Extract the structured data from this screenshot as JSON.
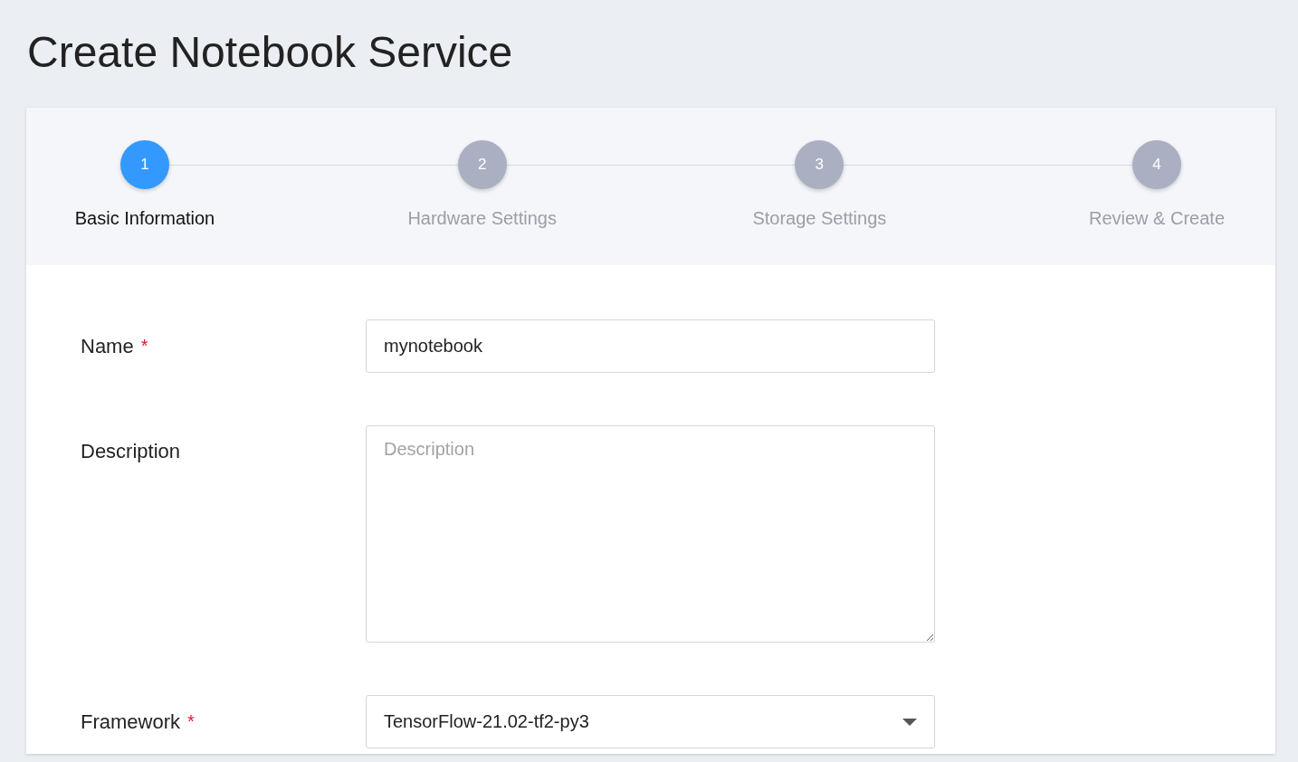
{
  "title": "Create Notebook Service",
  "steps": [
    {
      "number": "1",
      "label": "Basic Information",
      "selected": true
    },
    {
      "number": "2",
      "label": "Hardware Settings",
      "selected": false
    },
    {
      "number": "3",
      "label": "Storage Settings",
      "selected": false
    },
    {
      "number": "4",
      "label": "Review & Create",
      "selected": false
    }
  ],
  "fields": [
    {
      "kind": "text",
      "label": "Name",
      "required_mark": "*",
      "value": "mynotebook"
    },
    {
      "kind": "textarea",
      "label": "Description",
      "placeholder": "Description"
    },
    {
      "kind": "select",
      "label": "Framework",
      "required_mark": "*",
      "value": "TensorFlow-21.02-tf2-py3"
    }
  ]
}
